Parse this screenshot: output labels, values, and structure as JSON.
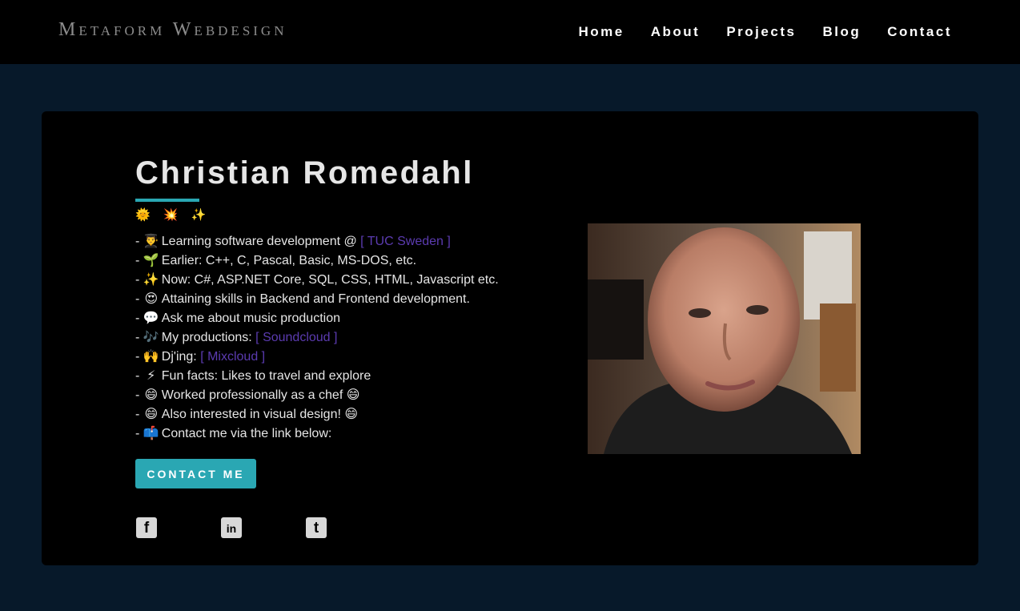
{
  "brand": "Metaform Webdesign",
  "nav": [
    "Home",
    "About",
    "Projects",
    "Blog",
    "Contact"
  ],
  "profile": {
    "name": "Christian Romedahl",
    "sparkles": "🌞 💥 ✨",
    "bio": [
      {
        "emoji": "👨‍🎓",
        "text": "Learning software development @ ",
        "link": "[ TUC Sweden ]"
      },
      {
        "emoji": "🌱",
        "text": "Earlier: C++, C, Pascal, Basic, MS-DOS, etc."
      },
      {
        "emoji": "✨",
        "text": "Now: C#, ASP.NET Core, SQL, CSS, HTML, Javascript etc."
      },
      {
        "emoji": "😍",
        "text": "Attaining skills in Backend and Frontend development."
      },
      {
        "emoji": "💬",
        "text": "Ask me about music production"
      },
      {
        "emoji": "🎶",
        "text": "My productions: ",
        "link": "[ Soundcloud ]"
      },
      {
        "emoji": "🙌",
        "text": "Dj'ing: ",
        "link": "[ Mixcloud ]"
      },
      {
        "emoji": "⚡",
        "text": "Fun facts: Likes to travel and explore"
      },
      {
        "emoji": "😄",
        "text": "Worked professionally as a chef 😄"
      },
      {
        "emoji": "😄",
        "text": "Also interested in visual design! 😄"
      },
      {
        "emoji": "📫",
        "text": "Contact me via the link below:"
      }
    ],
    "cta_label": "CONTACT ME"
  },
  "social": [
    {
      "name": "facebook-icon",
      "glyph": "f"
    },
    {
      "name": "linkedin-icon",
      "glyph": "in"
    },
    {
      "name": "twitter-icon",
      "glyph": "t"
    }
  ],
  "colors": {
    "accent": "#2aa7b3",
    "link": "#5b3bb0",
    "page_bg": "#07192a"
  }
}
